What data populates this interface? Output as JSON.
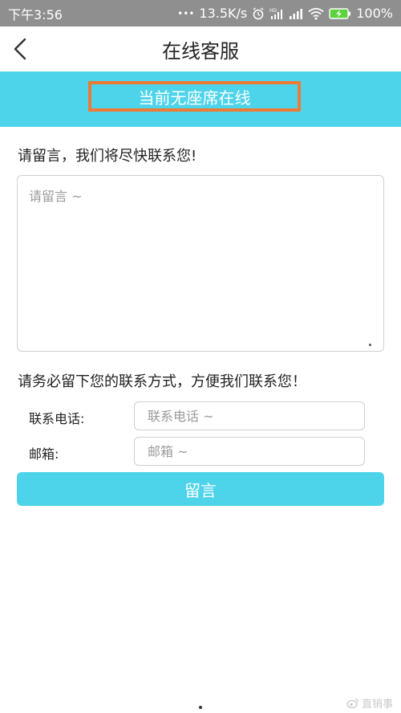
{
  "status_bar": {
    "time": "下午3:56",
    "dots": "•••",
    "net_speed": "13.5K/s",
    "battery_pct": "100%",
    "icons": [
      "alarm-icon",
      "signal-hd-icon",
      "signal-icon",
      "wifi-icon",
      "battery-charging-icon"
    ]
  },
  "nav": {
    "title": "在线客服",
    "back_icon": "chevron-left-icon"
  },
  "banner": {
    "text": "当前无座席在线",
    "highlight_color": "#ed7a35",
    "bg_color": "#4dd3ea"
  },
  "message": {
    "prompt": "请留言，我们将尽快联系您!",
    "placeholder": "请留言 ~"
  },
  "contact": {
    "prompt": "请务必留下您的联系方式，方便我们联系您！",
    "phone_label": "联系电话:",
    "phone_placeholder": "联系电话 ~",
    "email_label": "邮箱:",
    "email_placeholder": "邮箱 ~"
  },
  "submit": {
    "label": "留言"
  },
  "watermark": {
    "text": "直销事"
  }
}
